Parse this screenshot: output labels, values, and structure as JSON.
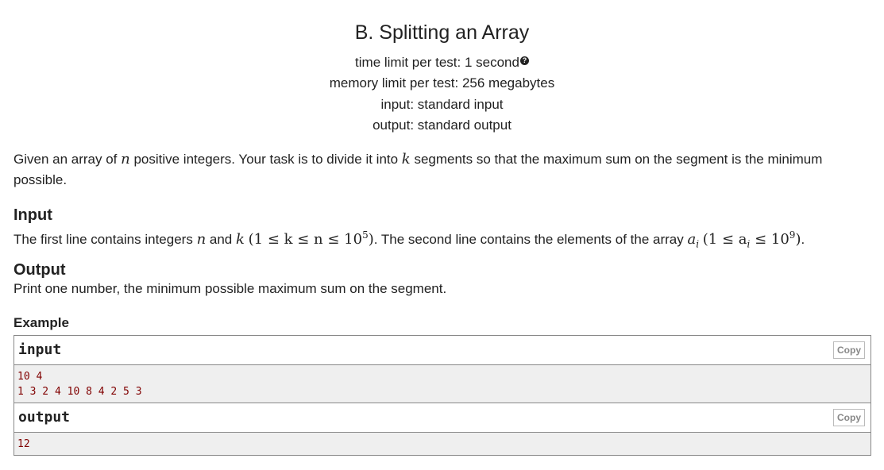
{
  "problem": {
    "title": "B. Splitting an Array",
    "time_limit": "time limit per test: 1 second",
    "memory_limit": "memory limit per test: 256 megabytes",
    "input_file": "input: standard input",
    "output_file": "output: standard output"
  },
  "statement": {
    "part1": "Given an array of ",
    "var_n": "n",
    "part2": " positive integers. Your task is to divide it into ",
    "var_k": "k",
    "part3": " segments so that the maximum sum on the segment is the minimum possible."
  },
  "input_section": {
    "title": "Input",
    "part1": "The first line contains integers ",
    "var_n": "n",
    "and": " and ",
    "var_k": "k",
    "constraint1": "(1 ≤ k ≤ n ≤ 10",
    "exp1": "5",
    "close1": ")",
    "part2": ". The second line contains the elements of the array ",
    "var_a": "a",
    "sub_i": "i",
    "constraint2": "(1 ≤ a",
    "sub_i2": "i",
    "constraint2b": " ≤ 10",
    "exp2": "9",
    "close2": ")",
    "end": "."
  },
  "output_section": {
    "title": "Output",
    "text": "Print one number, the minimum possible maximum sum on the segment."
  },
  "example": {
    "title": "Example",
    "input_label": "input",
    "input_copy": "Copy",
    "input_lines": "10 4\n1 3 2 4 10 8 4 2 5 3",
    "output_label": "output",
    "output_copy": "Copy",
    "output_lines": "12"
  }
}
